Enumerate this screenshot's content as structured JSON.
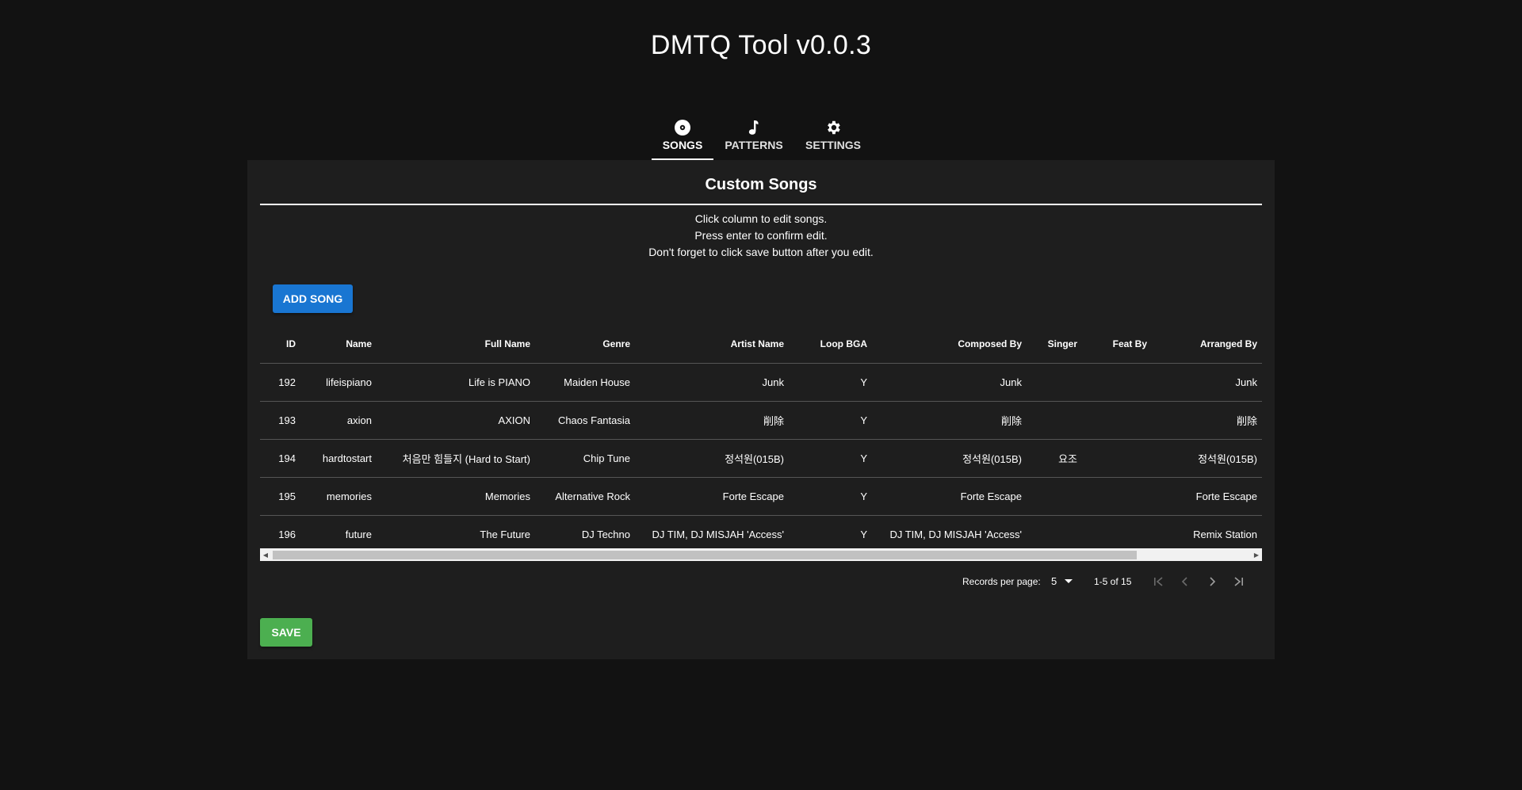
{
  "app": {
    "title": "DMTQ Tool v0.0.3"
  },
  "tabs": [
    {
      "label": "SONGS",
      "icon": "disc-icon",
      "active": true
    },
    {
      "label": "PATTERNS",
      "icon": "music-note-icon",
      "active": false
    },
    {
      "label": "SETTINGS",
      "icon": "gear-icon",
      "active": false
    }
  ],
  "card": {
    "title": "Custom Songs",
    "instructions": [
      "Click column to edit songs.",
      "Press enter to confirm edit.",
      "Don't forget to click save button after you edit."
    ],
    "add_button": "ADD SONG",
    "save_button": "SAVE"
  },
  "table": {
    "columns": [
      "ID",
      "Name",
      "Full Name",
      "Genre",
      "Artist Name",
      "Loop BGA",
      "Composed By",
      "Singer",
      "Feat By",
      "Arranged By"
    ],
    "rows": [
      [
        "192",
        "lifeispiano",
        "Life is PIANO",
        "Maiden House",
        "Junk",
        "Y",
        "Junk",
        "",
        "",
        "Junk"
      ],
      [
        "193",
        "axion",
        "AXION",
        "Chaos Fantasia",
        "削除",
        "Y",
        "削除",
        "",
        "",
        "削除"
      ],
      [
        "194",
        "hardtostart",
        "처음만 힘들지 (Hard to Start)",
        "Chip Tune",
        "정석원(015B)",
        "Y",
        "정석원(015B)",
        "요조",
        "",
        "정석원(015B)"
      ],
      [
        "195",
        "memories",
        "Memories",
        "Alternative Rock",
        "Forte Escape",
        "Y",
        "Forte Escape",
        "",
        "",
        "Forte Escape"
      ],
      [
        "196",
        "future",
        "The Future",
        "DJ Techno",
        "DJ TIM, DJ MISJAH 'Access'",
        "Y",
        "DJ TIM, DJ MISJAH 'Access'",
        "",
        "",
        "Remix Station"
      ]
    ]
  },
  "pagination": {
    "records_per_page_label": "Records per page:",
    "records_per_page_value": "5",
    "range_text": "1-5 of 15"
  },
  "colors": {
    "background": "#121212",
    "card": "#1e1e1e",
    "primary": "#1976d2",
    "success": "#4caf50"
  }
}
